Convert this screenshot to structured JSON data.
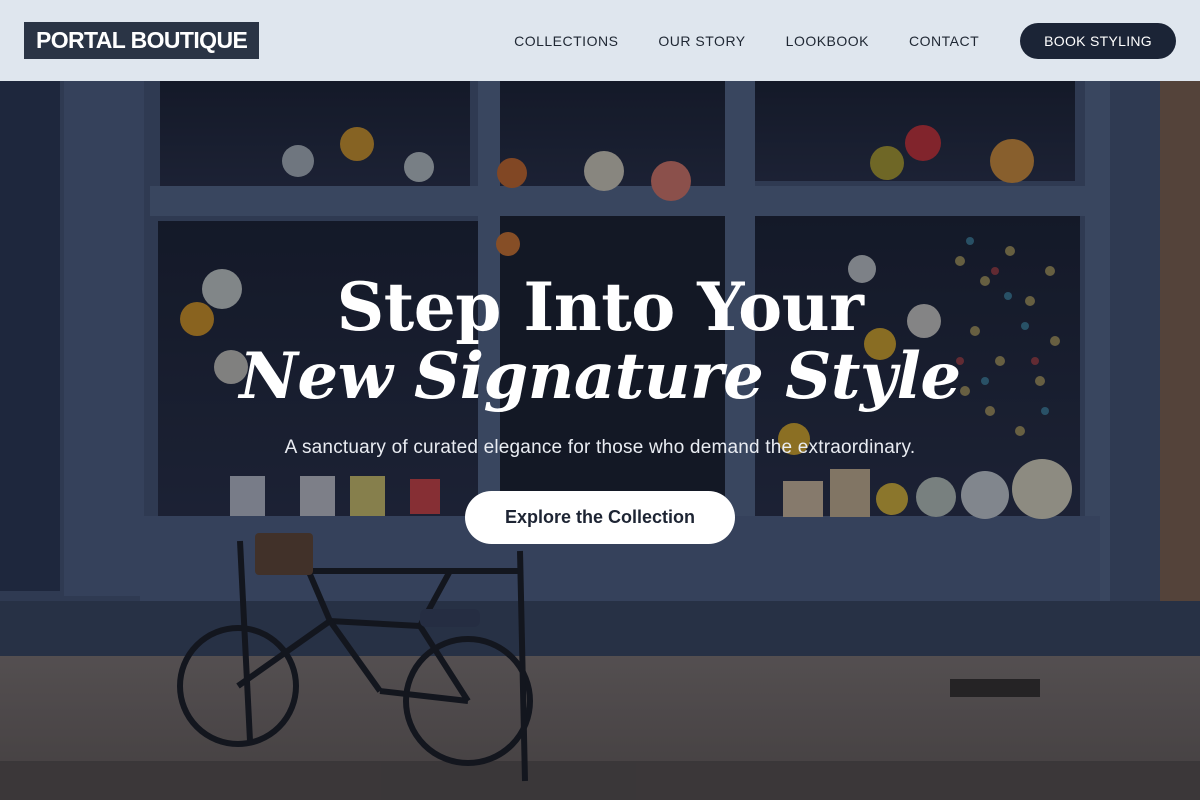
{
  "nav": {
    "logo": "PORTAL BOUTIQUE",
    "links": [
      "COLLECTIONS",
      "OUR STORY",
      "LOOKBOOK",
      "CONTACT"
    ],
    "cta": "BOOK STYLING"
  },
  "hero": {
    "title_line1": "Step Into Your",
    "title_line2": "New Signature Style",
    "subtitle": "A sanctuary of curated elegance for those who demand the extraordinary.",
    "button": "Explore the Collection"
  },
  "colors": {
    "nav_bg": "#dfe6ee",
    "logo_bg": "#2a3445",
    "cta_bg": "#1b2436",
    "storefront": "#4a5a7a"
  }
}
